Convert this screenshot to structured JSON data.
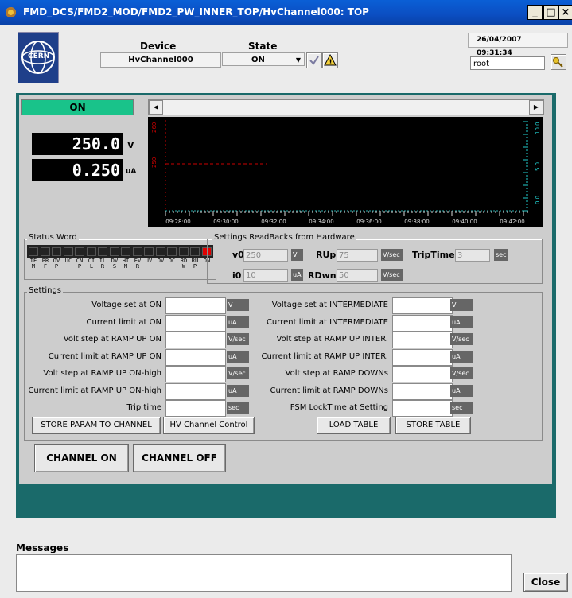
{
  "window": {
    "title": "FMD_DCS/FMD2_MOD/FMD2_PW_INNER_TOP/HvChannel000: TOP",
    "buttons": [
      "_",
      "□",
      "×"
    ]
  },
  "header": {
    "device_label": "Device",
    "device_value": "HvChannel000",
    "state_label": "State",
    "state_value": "ON",
    "date": "26/04/2007",
    "time": "09:31:34",
    "user": "root",
    "logo_text": "CERN"
  },
  "channel": {
    "state_text": "ON",
    "state_color": "#19c38a",
    "voltage_value": "250.0",
    "voltage_unit": "V",
    "current_value": "0.250",
    "current_unit": "uA"
  },
  "trend": {
    "left_axis_top": "260",
    "left_axis_mid": "250",
    "right_axis_ticks": [
      "10.0",
      "5.0",
      "0.0"
    ],
    "time_ticks": [
      "09:28:00",
      "09:30:00",
      "09:32:00",
      "09:34:00",
      "09:36:00",
      "09:38:00",
      "09:40:00",
      "09:42:00"
    ]
  },
  "status_word": {
    "title": "Status Word",
    "bits": [
      {
        "label": "TEM",
        "on": false
      },
      {
        "label": "PRF",
        "on": false
      },
      {
        "label": "OVP",
        "on": false
      },
      {
        "label": "UC",
        "on": false
      },
      {
        "label": "CNP",
        "on": false
      },
      {
        "label": "CIL",
        "on": false
      },
      {
        "label": "ILR",
        "on": false
      },
      {
        "label": "DVS",
        "on": false
      },
      {
        "label": "HTM",
        "on": false
      },
      {
        "label": "EVR",
        "on": false
      },
      {
        "label": "UV",
        "on": false
      },
      {
        "label": "OV",
        "on": false
      },
      {
        "label": "OC",
        "on": false
      },
      {
        "label": "RDW",
        "on": false
      },
      {
        "label": "RUP",
        "on": false
      },
      {
        "label": "ON",
        "on": true
      }
    ],
    "on_color": "#e00000",
    "off_color": "#222222"
  },
  "readbacks": {
    "title": "Settings ReadBacks from Hardware",
    "v0_label": "v0",
    "v0_value": "250",
    "v0_unit": "V",
    "i0_label": "i0",
    "i0_value": "10",
    "i0_unit": "uA",
    "rup_label": "RUp",
    "rup_value": "75",
    "rup_unit": "V/sec",
    "rdwn_label": "RDwn",
    "rdwn_value": "50",
    "rdwn_unit": "V/sec",
    "trip_label": "TripTime",
    "trip_value": "3",
    "trip_unit": "sec"
  },
  "settings": {
    "title": "Settings",
    "left": [
      {
        "label": "Voltage set at ON",
        "unit": "V"
      },
      {
        "label": "Current limit at ON",
        "unit": "uA"
      },
      {
        "label": "Volt step at RAMP UP ON",
        "unit": "V/sec"
      },
      {
        "label": "Current limit at RAMP UP ON",
        "unit": "uA"
      },
      {
        "label": "Volt step at RAMP UP ON-high",
        "unit": "V/sec"
      },
      {
        "label": "Current limit at RAMP UP ON-high",
        "unit": "uA"
      },
      {
        "label": "Trip time",
        "unit": "sec"
      }
    ],
    "right": [
      {
        "label": "Voltage set at INTERMEDIATE",
        "unit": "V"
      },
      {
        "label": "Current limit at INTERMEDIATE",
        "unit": "uA"
      },
      {
        "label": "Volt step at RAMP UP INTER.",
        "unit": "V/sec"
      },
      {
        "label": "Current limit at RAMP UP INTER.",
        "unit": "uA"
      },
      {
        "label": "Volt step at RAMP DOWNs",
        "unit": "V/sec"
      },
      {
        "label": "Current limit at RAMP DOWNs",
        "unit": "uA"
      },
      {
        "label": "FSM LockTime at Setting",
        "unit": "sec"
      }
    ],
    "store_param_label": "STORE PARAM TO CHANNEL",
    "hv_control_label": "HV Channel Control",
    "load_table_label": "LOAD TABLE",
    "store_table_label": "STORE TABLE"
  },
  "actions": {
    "channel_on_label": "CHANNEL ON",
    "channel_off_label": "CHANNEL OFF"
  },
  "messages": {
    "title": "Messages",
    "close_label": "Close"
  }
}
